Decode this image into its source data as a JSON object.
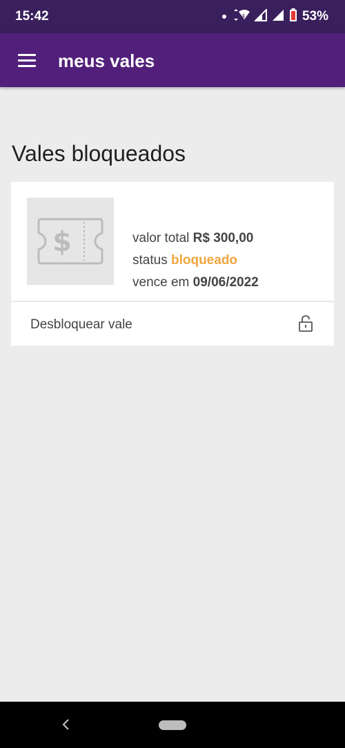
{
  "status_bar": {
    "time": "15:42",
    "battery": "53%",
    "icons": [
      "notification-dot-icon",
      "wifi-icon",
      "signal-icon",
      "signal-icon",
      "battery-icon"
    ]
  },
  "app_bar": {
    "title": "meus vales",
    "menu_icon": "hamburger-menu-icon"
  },
  "section": {
    "title": "Vales bloqueados"
  },
  "voucher": {
    "icon": "voucher-ticket-icon",
    "total_label": "valor total",
    "total_value": "R$ 300,00",
    "status_label": "status",
    "status_value": "bloqueado",
    "expires_label": "vence em",
    "expires_value": "09/06/2022",
    "action_label": "Desbloquear vale",
    "action_icon": "unlock-icon"
  },
  "colors": {
    "status_bar": "#3a1f5d",
    "app_bar": "#52207a",
    "status_accent": "#f0a640"
  },
  "nav_bar": {
    "icons": [
      "back-icon",
      "home-pill-icon"
    ]
  }
}
